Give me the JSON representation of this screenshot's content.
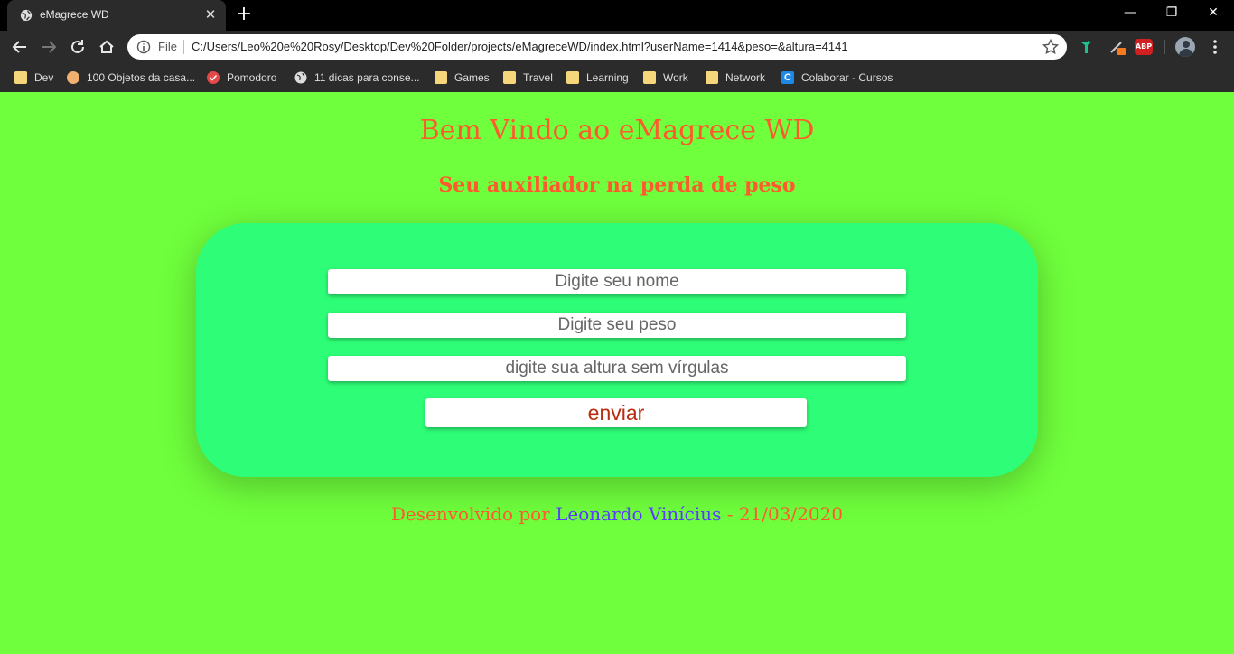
{
  "browser": {
    "tab": {
      "title": "eMagrece WD",
      "close": "✕"
    },
    "new_tab": "+",
    "window": {
      "minimize": "—",
      "restore": "❐",
      "close": "✕"
    },
    "omnibox": {
      "scheme_label": "File",
      "url": "C:/Users/Leo%20e%20Rosy/Desktop/Dev%20Folder/projects/eMagreceWD/index.html?userName=1414&peso=&altura=4141"
    },
    "bookmarks": [
      {
        "label": "Dev",
        "icon": "folder-icon"
      },
      {
        "label": "100 Objetos da casa...",
        "icon": "site-favicon"
      },
      {
        "label": "Pomodoro",
        "icon": "check-circle-icon"
      },
      {
        "label": "11 dicas para conse...",
        "icon": "globe-icon"
      },
      {
        "label": "Games",
        "icon": "folder-icon"
      },
      {
        "label": "Travel",
        "icon": "folder-icon"
      },
      {
        "label": "Learning",
        "icon": "folder-icon"
      },
      {
        "label": "Work",
        "icon": "folder-icon"
      },
      {
        "label": "Network",
        "icon": "folder-icon"
      },
      {
        "label": "Colaborar - Cursos",
        "icon": "colaborar-icon"
      }
    ],
    "extensions": {
      "abp_label": "ABP"
    }
  },
  "page": {
    "title": "Bem Vindo ao eMagrece WD",
    "subtitle": "Seu auxiliador na perda de peso",
    "form": {
      "name_placeholder": "Digite seu nome",
      "weight_placeholder": "Digite seu peso",
      "height_placeholder": "digite sua altura sem vírgulas",
      "submit_label": "enviar"
    },
    "footer": {
      "prefix": "Desenvolvido por ",
      "author": "Leonardo Vinícius",
      "suffix": " - 21/03/2020"
    }
  },
  "colors": {
    "page_bg": "#6fff3c",
    "card_bg": "#2efd77",
    "heading": "#ff5a2d",
    "author_link": "#5b3cff",
    "button_text": "#b82d10"
  }
}
